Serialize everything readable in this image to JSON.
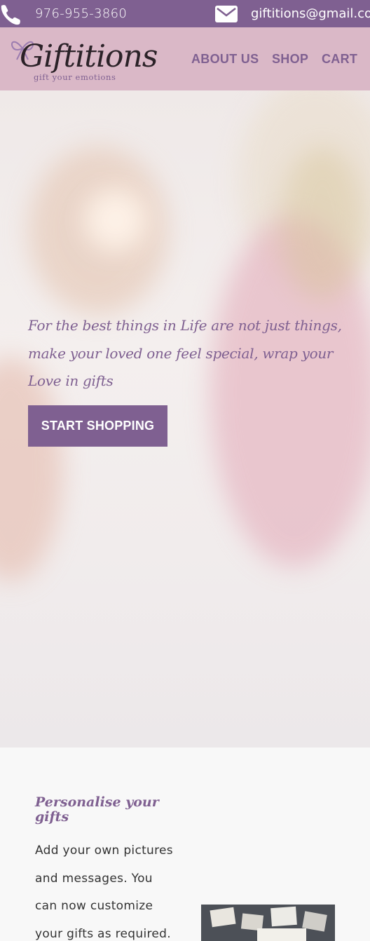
{
  "topbar": {
    "phone_icon": "phone-icon",
    "phone": "976-955-3860",
    "mail_icon": "mail-icon",
    "email": "giftitions@gmail.com"
  },
  "header": {
    "logo_text": "Giftitions",
    "logo_tagline": "gift your emotions",
    "nav": [
      "ABOUT US",
      "SHOP",
      "CART"
    ]
  },
  "hero": {
    "text": "For the best things in Life are not just things, make your loved one feel special, wrap your Love in gifts",
    "button": "START SHOPPING"
  },
  "section": {
    "title": "Personalise your gifts",
    "body": "Add your own pictures and messages. You can now customize your gifts as required. This"
  },
  "colors": {
    "primary": "#7f6091",
    "header_bg": "#dab8c7",
    "page_bg": "#f8f8f8"
  }
}
